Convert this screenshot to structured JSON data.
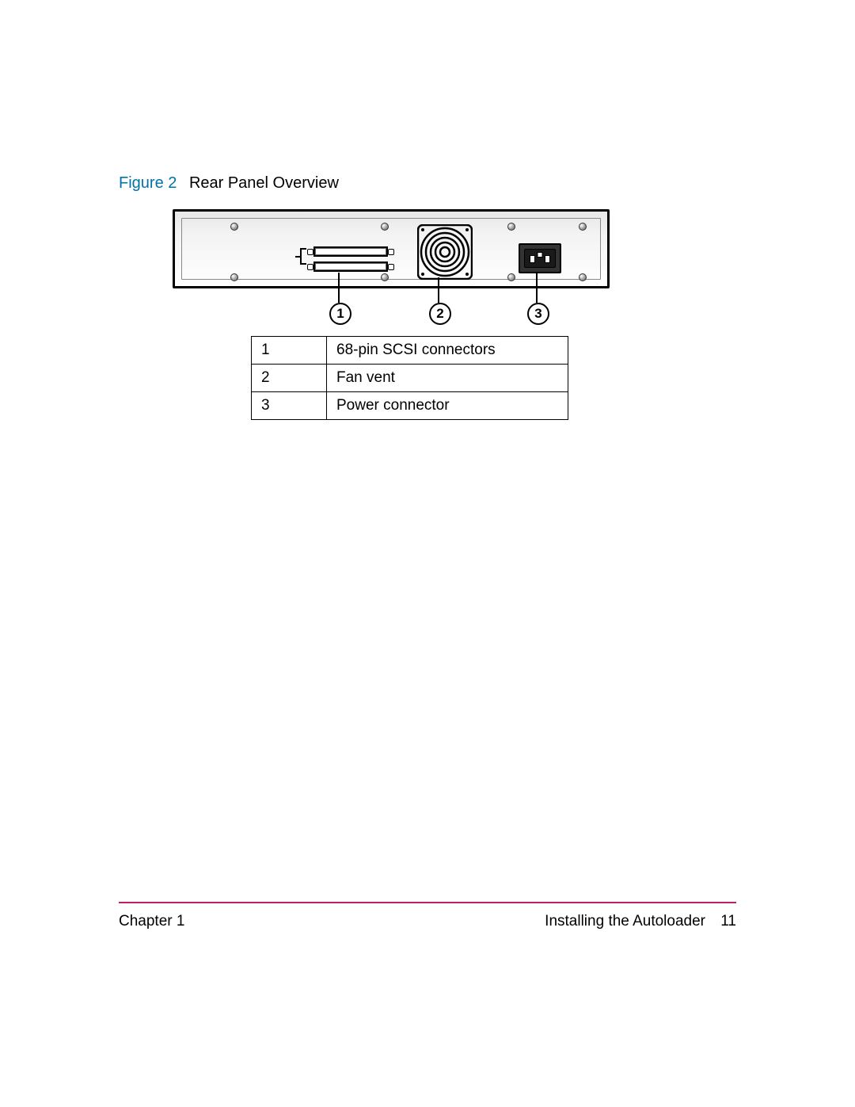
{
  "caption": {
    "label": "Figure 2",
    "title": "Rear Panel Overview"
  },
  "callouts": {
    "c1": "1",
    "c2": "2",
    "c3": "3"
  },
  "legend": {
    "rows": [
      {
        "num": "1",
        "desc": "68-pin SCSI connectors"
      },
      {
        "num": "2",
        "desc": "Fan vent"
      },
      {
        "num": "3",
        "desc": "Power connector"
      }
    ]
  },
  "footer": {
    "left": "Chapter 1",
    "section": "Installing the Autoloader",
    "page": "11"
  }
}
